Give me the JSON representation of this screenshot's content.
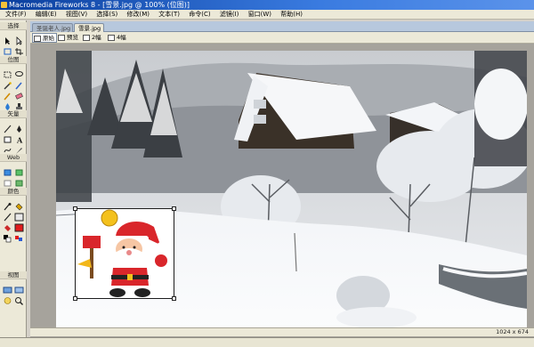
{
  "window": {
    "title": "Macromedia Fireworks 8 - [雪景.jpg @ 100% (位图)]"
  },
  "menu": {
    "items": [
      "文件(F)",
      "编辑(E)",
      "视图(V)",
      "选择(S)",
      "修改(M)",
      "文本(T)",
      "命令(C)",
      "滤镜(I)",
      "窗口(W)",
      "帮助(H)"
    ]
  },
  "tools": {
    "sections": [
      "选择",
      "位图",
      "矢量",
      "Web",
      "颜色",
      "视图"
    ]
  },
  "document": {
    "tabs": [
      {
        "label": "圣诞老人.jpg",
        "active": false
      },
      {
        "label": "雪景.jpg",
        "active": true
      }
    ],
    "view_buttons": [
      {
        "label": "原始",
        "active": true,
        "icon": "original-view-icon"
      },
      {
        "label": "预览",
        "active": false,
        "icon": "preview-icon"
      },
      {
        "label": "2幅",
        "active": false,
        "icon": "two-up-icon"
      },
      {
        "label": "4幅",
        "active": false,
        "icon": "four-up-icon"
      }
    ],
    "status_dimensions": "1024 x 674"
  },
  "colors": {
    "accent": "#0a3f9e",
    "panel": "#ece9d8",
    "canvas_bg": "#a6a39c"
  }
}
